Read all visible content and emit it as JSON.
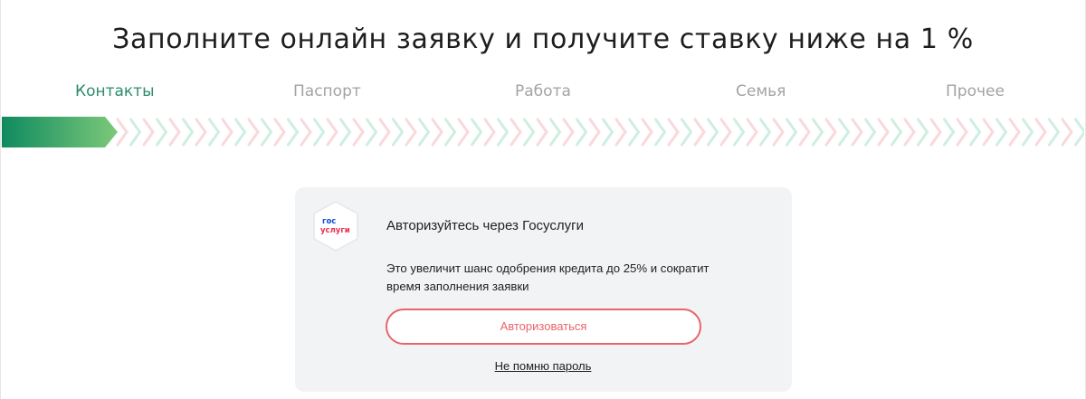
{
  "page": {
    "title": "Заполните онлайн заявку и получите ставку ниже на 1 %"
  },
  "steps": [
    {
      "label": "Контакты",
      "active": true
    },
    {
      "label": "Паспорт",
      "active": false
    },
    {
      "label": "Работа",
      "active": false
    },
    {
      "label": "Семья",
      "active": false
    },
    {
      "label": "Прочее",
      "active": false
    }
  ],
  "progress": {
    "current_step": 1,
    "total_steps": 5,
    "fill_start_color": "#0f8a5f",
    "fill_end_color": "#7cc97a",
    "chevron_green": "#cfeee2",
    "chevron_red": "#f9d9dc"
  },
  "gosuslugi": {
    "logo_text_top": "гос",
    "logo_text_bottom": "услуги",
    "title": "Авторизуйтесь через Госуслуги",
    "description": "Это увеличит шанс одобрения кредита до 25% и сократит время заполнения заявки",
    "auth_button_label": "Авторизоваться",
    "forgot_password_label": "Не помню пароль"
  },
  "colors": {
    "active_step": "#2e8b6a",
    "inactive_step": "#a3a3a3",
    "accent_red": "#e8646a",
    "logo_blue": "#0d4cd3",
    "logo_red": "#ee2f53",
    "card_bg": "#f2f3f5"
  },
  "icons": {
    "logo": "gosuslugi-logo-icon"
  }
}
